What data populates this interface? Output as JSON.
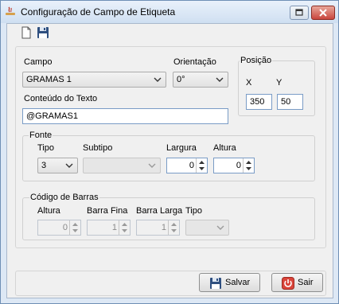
{
  "window": {
    "title": "Configuração de Campo de Etiqueta"
  },
  "toolbar": {
    "new_icon": "new-document-icon",
    "save_icon": "save-floppy-icon"
  },
  "main": {
    "campo_label": "Campo",
    "campo_value": "GRAMAS 1",
    "orientacao_label": "Orientação",
    "orientacao_value": "0°",
    "posicao_label": "Posição",
    "x_label": "X",
    "y_label": "Y",
    "x_value": "350",
    "y_value": "50",
    "conteudo_label": "Conteúdo do Texto",
    "conteudo_value": "@GRAMAS1"
  },
  "fonte": {
    "legend": "Fonte",
    "tipo_label": "Tipo",
    "tipo_value": "3",
    "subtipo_label": "Subtipo",
    "subtipo_value": "",
    "largura_label": "Largura",
    "largura_value": "0",
    "altura_label": "Altura",
    "altura_value": "0"
  },
  "barcode": {
    "legend": "Código de Barras",
    "altura_label": "Altura",
    "altura_value": "0",
    "barra_fina_label": "Barra Fina",
    "barra_fina_value": "1",
    "barra_larga_label": "Barra Larga",
    "barra_larga_value": "1",
    "tipo_label": "Tipo",
    "tipo_value": ""
  },
  "buttons": {
    "salvar_label": "Salvar",
    "sair_label": "Sair"
  },
  "colors": {
    "accent": "#3c7fb1",
    "close_red": "#c9463d"
  }
}
